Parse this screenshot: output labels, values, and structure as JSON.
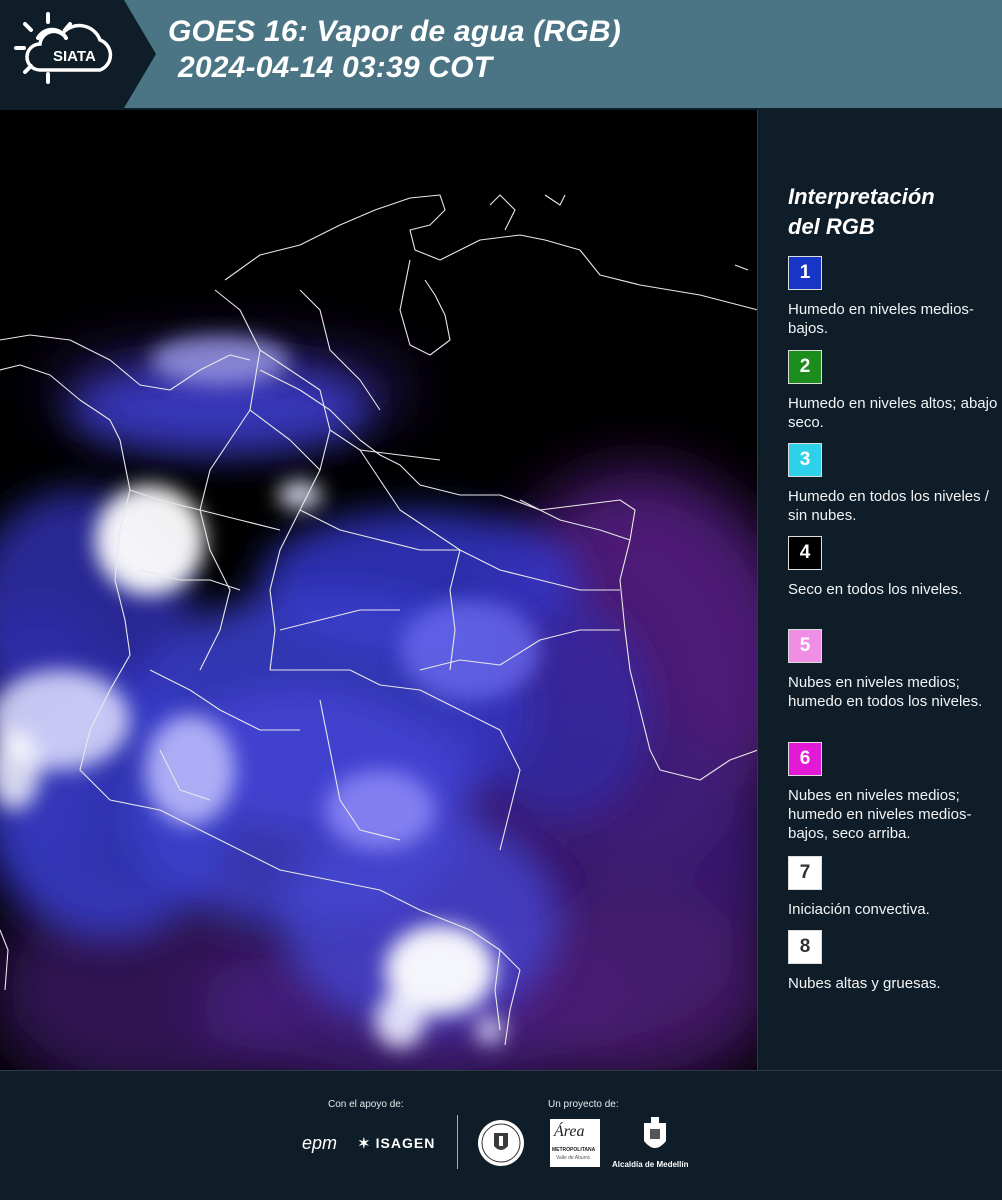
{
  "header": {
    "logo_text": "SIATA",
    "title_line1": "GOES 16: Vapor de agua (RGB)",
    "title_line2": "2024-04-14 03:39 COT",
    "background_color": "#4b7585"
  },
  "legend": {
    "title_line1": "Interpretación",
    "title_line2": "del RGB",
    "items": [
      {
        "number": "1",
        "color": "#1736c6",
        "text_color": "#ffffff",
        "description": "Humedo en niveles medios-bajos."
      },
      {
        "number": "2",
        "color": "#1c8c1c",
        "text_color": "#ffffff",
        "description": "Humedo en niveles altos; abajo seco."
      },
      {
        "number": "3",
        "color": "#2fd0ea",
        "text_color": "#ffffff",
        "description": "Humedo en todos los niveles / sin nubes."
      },
      {
        "number": "4",
        "color": "#000000",
        "text_color": "#ffffff",
        "description": "Seco en todos los niveles."
      },
      {
        "number": "5",
        "color": "#f08ee6",
        "text_color": "#ffffff",
        "description": "Nubes en niveles medios; humedo en todos los niveles."
      },
      {
        "number": "6",
        "color": "#e319d8",
        "text_color": "#ffffff",
        "description": "Nubes en niveles medios; humedo en niveles medios-bajos, seco arriba."
      },
      {
        "number": "7",
        "color": "#ffffff",
        "text_color": "#333333",
        "description": "Iniciación convectiva."
      },
      {
        "number": "8",
        "color": "#ffffff",
        "text_color": "#333333",
        "description": "Nubes altas y gruesas."
      }
    ]
  },
  "footer": {
    "support_label": "Con el apoyo de:",
    "project_label": "Un proyecto de:",
    "sponsor_epm": "epm",
    "sponsor_isagen": "ISAGEN",
    "area_name": "Área",
    "area_caption": "METROPOLITANA",
    "area_subcaption": "Valle de Aburrá",
    "alcaldia": "Alcaldía de Medellín"
  }
}
